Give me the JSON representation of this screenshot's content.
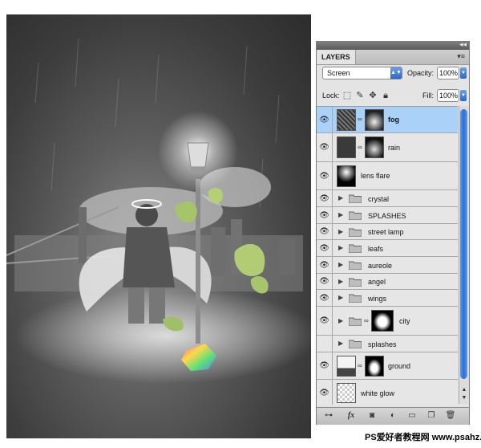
{
  "panel": {
    "tab_label": "LAYERS",
    "blend_mode": "Screen",
    "opacity_label": "Opacity:",
    "opacity_value": "100%",
    "lock_label": "Lock:",
    "fill_label": "Fill:",
    "fill_value": "100%"
  },
  "layers": [
    {
      "name": "fog",
      "kind": "layer-mask",
      "selected": true
    },
    {
      "name": "rain",
      "kind": "layer-mask",
      "selected": false
    },
    {
      "name": "lens flare",
      "kind": "layer",
      "selected": false
    },
    {
      "name": "crystal",
      "kind": "group",
      "selected": false
    },
    {
      "name": "SPLASHES",
      "kind": "group",
      "selected": false
    },
    {
      "name": "street lamp",
      "kind": "group",
      "selected": false
    },
    {
      "name": "leafs",
      "kind": "group",
      "selected": false
    },
    {
      "name": "aureole",
      "kind": "group",
      "selected": false
    },
    {
      "name": "angel",
      "kind": "group",
      "selected": false
    },
    {
      "name": "wings",
      "kind": "group",
      "selected": false
    },
    {
      "name": "city",
      "kind": "group-mask",
      "selected": false
    },
    {
      "name": "splashes",
      "kind": "group",
      "selected": false
    },
    {
      "name": "ground",
      "kind": "layer-mask",
      "selected": false
    },
    {
      "name": "white glow",
      "kind": "layer",
      "selected": false
    }
  ],
  "footer_icons": [
    "link-layers-icon",
    "fx-icon",
    "add-mask-icon",
    "adjustment-layer-icon",
    "new-group-icon",
    "new-layer-icon",
    "trash-icon"
  ],
  "watermark": "PS爱好者教程网 www.psahz.com",
  "colors": {
    "selected_row": "#aad1f7",
    "scroll_thumb": "#2c6fd6"
  }
}
